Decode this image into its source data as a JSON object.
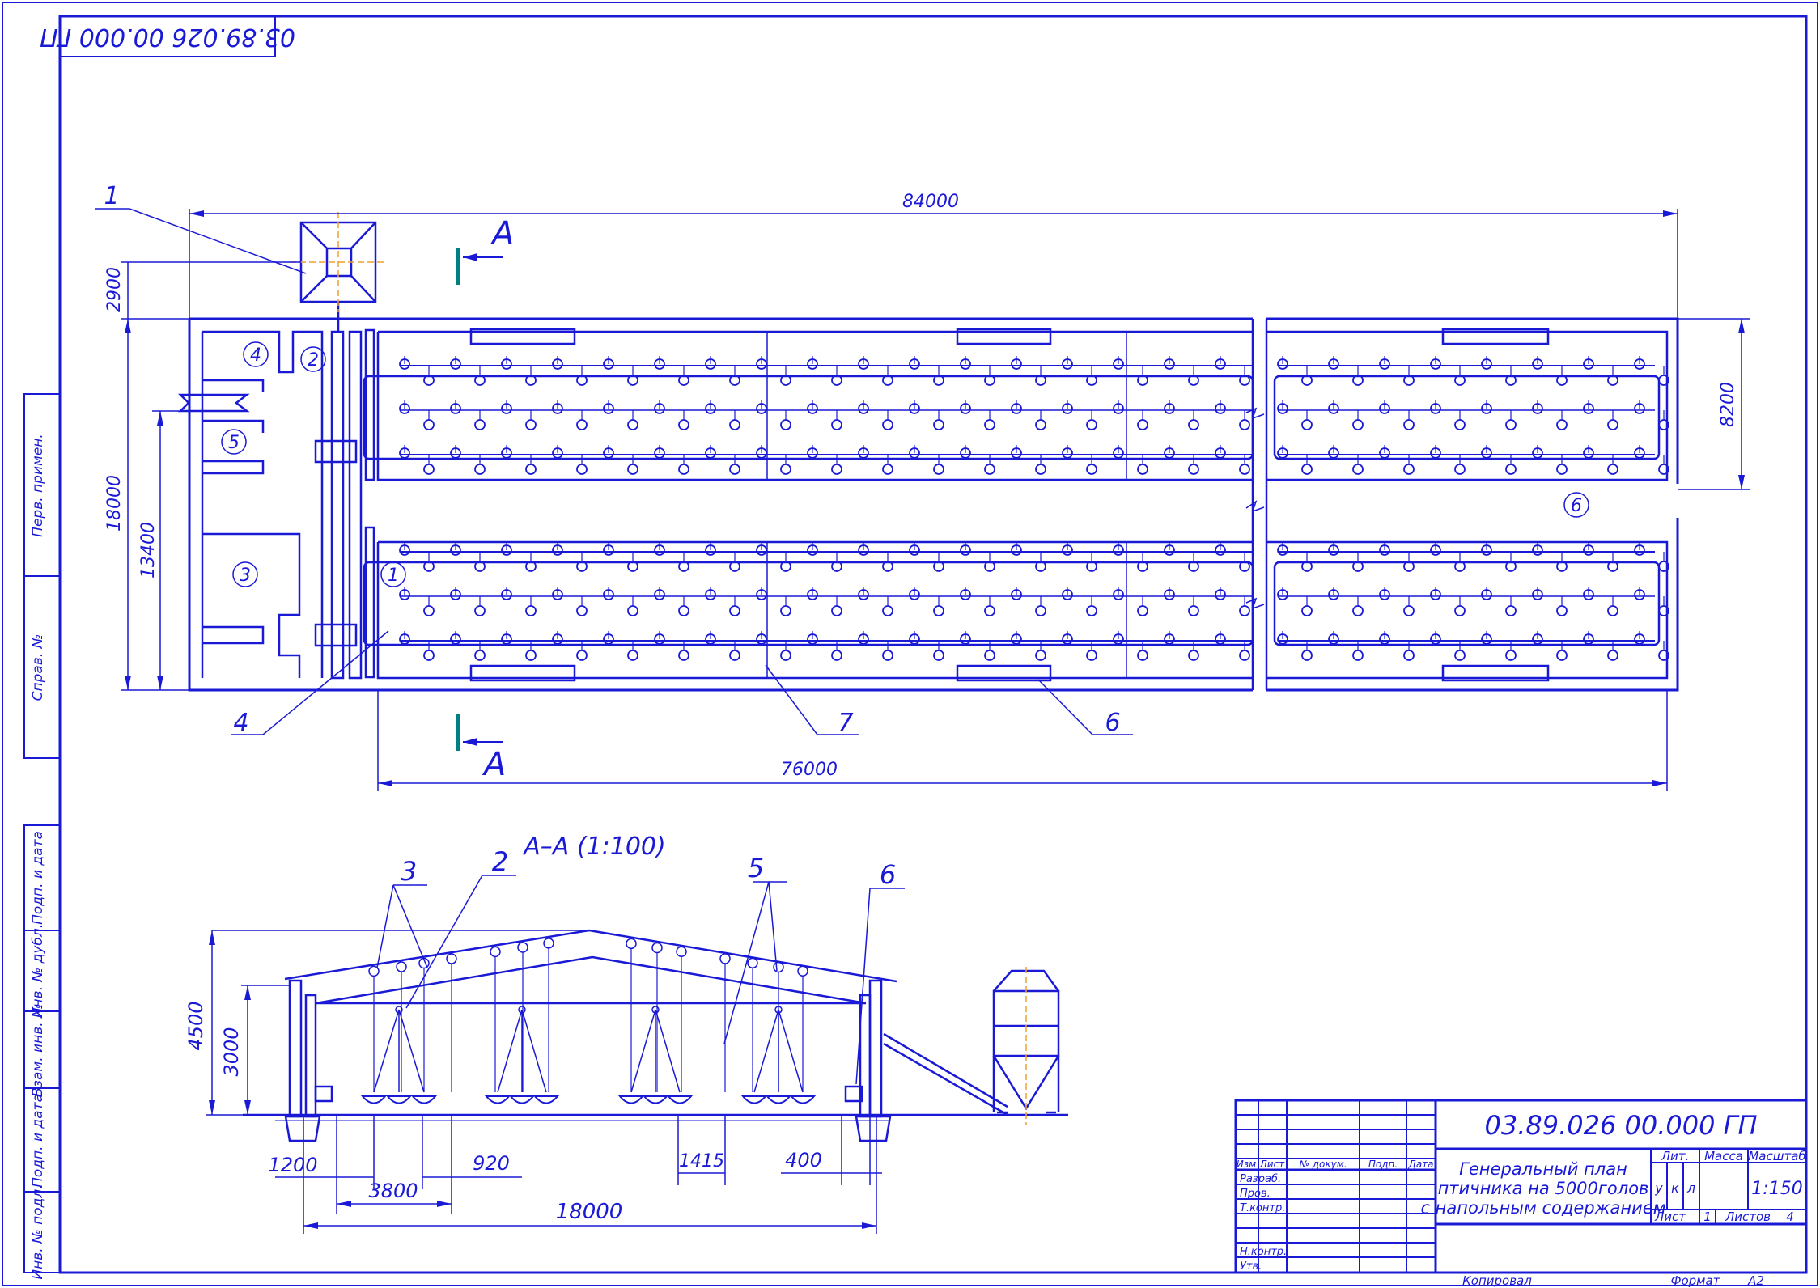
{
  "drawing": {
    "designation": "03.89.026 00.000 ГП",
    "designation_mirrored": "03.89.026 00.000 ГП",
    "title_lines": [
      "Генеральный план",
      "птичника на 5000голов",
      "с напольным содержанием"
    ],
    "scale": "1:150",
    "sheet_label": "Лист",
    "sheet_no": "1",
    "sheets_label": "Листов",
    "sheets_total": "4",
    "lit_label": "Лит.",
    "mass_label": "Масса",
    "scale_label": "Масштаб",
    "lit_values": [
      "у",
      "к",
      "л"
    ],
    "copied_label": "Копировал",
    "format_label": "Формат",
    "format_value": "А2",
    "columns": [
      "Изм",
      "Лист",
      "№ докум.",
      "Подп.",
      "Дата"
    ],
    "roles": [
      "Разраб.",
      "Пров.",
      "Т.контр.",
      "Н.контр.",
      "Утв."
    ]
  },
  "side_stamp": [
    "Перв. примен.",
    "Справ. №",
    "Подп. и дата",
    "Инв. № дубл.",
    "Взам. инв. №",
    "Подп. и дата",
    "Инв. № подл."
  ],
  "plan": {
    "dims": {
      "total_length": "84000",
      "inner_length": "76000",
      "width": "18000",
      "width_inner": "13400",
      "offset": "2900",
      "bay": "8200"
    },
    "section_marks": [
      "А",
      "А"
    ],
    "callouts": [
      "1",
      "4",
      "7",
      "6"
    ],
    "room_numbers": [
      "4",
      "2",
      "5",
      "3",
      "1",
      "6"
    ]
  },
  "section": {
    "title": "А–А (1:100)",
    "dims": {
      "height_total": "4500",
      "height_wall": "3000",
      "d1200": "1200",
      "d3800": "3800",
      "d920": "920",
      "d1415": "1415",
      "d400": "400",
      "width": "18000"
    },
    "callouts": [
      "3",
      "2",
      "5",
      "6"
    ]
  },
  "colors": {
    "line": "#1a1ad6",
    "axis": "#f0a030",
    "mark": "#008080"
  }
}
